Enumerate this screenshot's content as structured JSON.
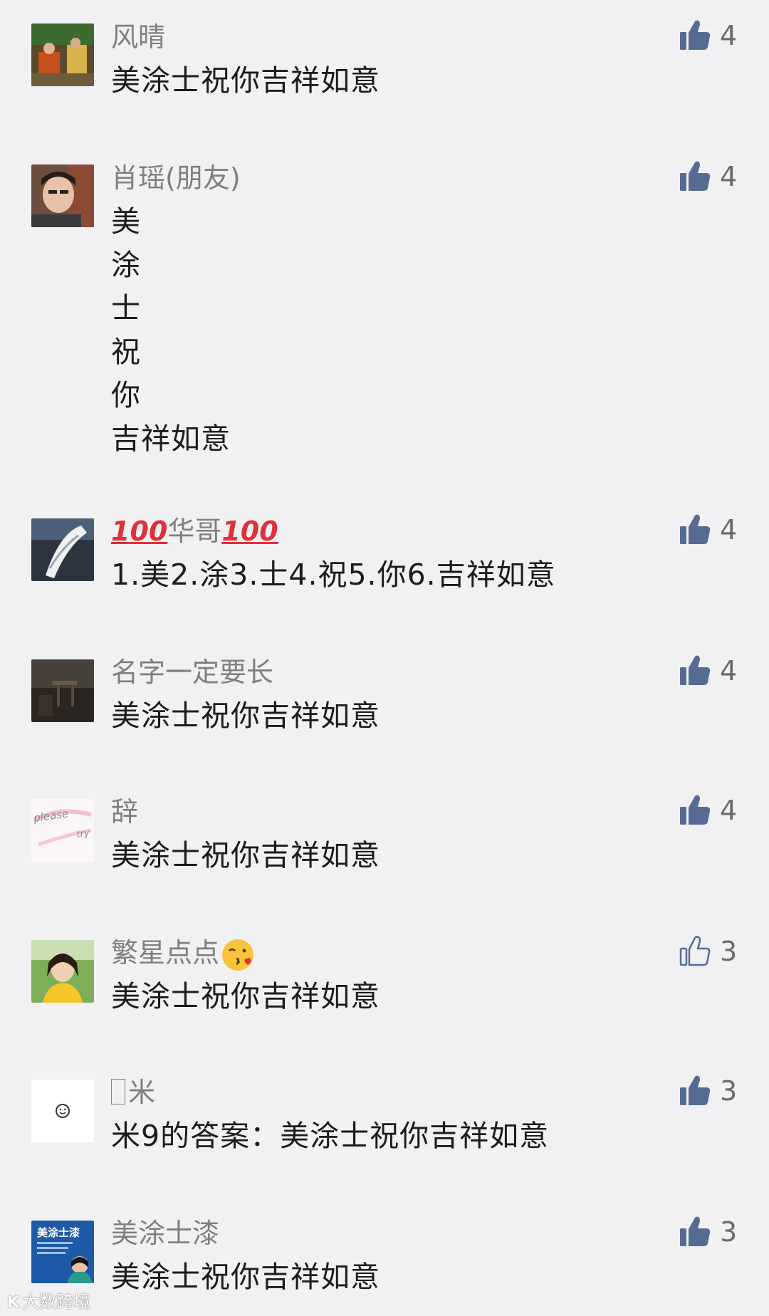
{
  "comments": [
    {
      "name": "风晴",
      "lines": [
        "美涂士祝你吉祥如意"
      ],
      "likes": "4",
      "liked": true
    },
    {
      "name": "肖瑶(朋友)",
      "lines": [
        "美",
        "涂",
        "士",
        "祝",
        "你",
        "吉祥如意"
      ],
      "likes": "4",
      "liked": true
    },
    {
      "name_prefix": "💯",
      "name": "华哥",
      "name_suffix": "💯",
      "lines": [
        "1.美2.涂3.士4.祝5.你6.吉祥如意"
      ],
      "likes": "4",
      "liked": true
    },
    {
      "name": "名字一定要长",
      "lines": [
        "美涂士祝你吉祥如意"
      ],
      "likes": "4",
      "liked": true
    },
    {
      "name": "辞",
      "lines": [
        "美涂士祝你吉祥如意"
      ],
      "likes": "4",
      "liked": true,
      "avatar_text_1": "please",
      "avatar_text_2": "try"
    },
    {
      "name": "繁星点点",
      "name_emoji": "kissing-face-icon",
      "lines": [
        "美涂士祝你吉祥如意"
      ],
      "likes": "3",
      "liked": false
    },
    {
      "name": "米",
      "lines": [
        "米9的答案：美涂士祝你吉祥如意"
      ],
      "likes": "3",
      "liked": true
    },
    {
      "name": "美涂士漆",
      "lines": [
        "美涂士祝你吉祥如意"
      ],
      "likes": "3",
      "liked": true,
      "avatar_text": "美涂士漆"
    }
  ],
  "watermark": {
    "logo": "K",
    "text": "大数跨境"
  },
  "colors": {
    "like_filled": "#566b94",
    "like_outline": "#566b94",
    "background": "#f1f1f3"
  }
}
